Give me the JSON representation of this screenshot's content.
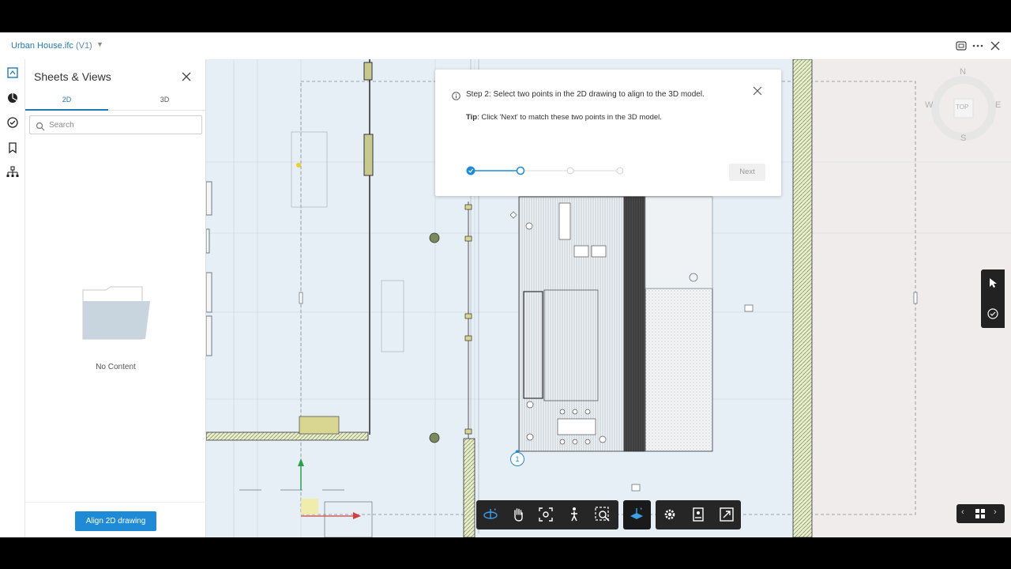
{
  "header": {
    "file_name": "Urban House.ifc",
    "version": "(V1)",
    "icons": [
      "window-icon",
      "more-icon",
      "close-icon"
    ]
  },
  "rail": {
    "items": [
      "sheets-icon",
      "model-icon",
      "issues-icon",
      "bookmark-icon",
      "hierarchy-icon"
    ]
  },
  "panel": {
    "title": "Sheets & Views",
    "tabs": [
      {
        "label": "2D",
        "active": true
      },
      {
        "label": "3D",
        "active": false
      }
    ],
    "search_placeholder": "Search",
    "empty_text": "No Content",
    "align_button": "Align 2D drawing"
  },
  "dialog": {
    "step_text": "Step 2: Select two points in the 2D drawing to align to the 3D model.",
    "tip_label": "Tip",
    "tip_text": ": Click 'Next' to match these two points in the 3D model.",
    "next_label": "Next",
    "steps_total": 4,
    "current_step": 2
  },
  "compass": {
    "n": "N",
    "s": "S",
    "e": "E",
    "w": "W",
    "top": "TOP"
  },
  "marker": {
    "label": "1"
  },
  "colors": {
    "accent": "#1f8bd6",
    "toolbar_bg": "#262626",
    "viewport_bg": "#e7eff5"
  },
  "toolbar": {
    "tools": [
      "orbit-icon",
      "pan-icon",
      "fit-icon",
      "walk-icon",
      "zoom-region-icon",
      "section-icon",
      "settings-icon",
      "properties-icon",
      "fullscreen-icon"
    ],
    "active_tool": "orbit-icon"
  }
}
